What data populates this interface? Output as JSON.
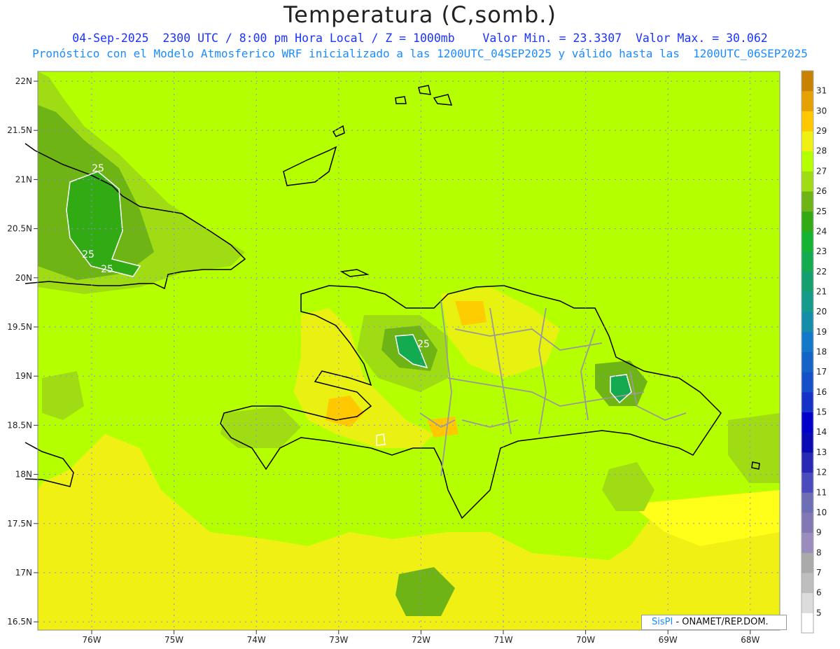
{
  "header": {
    "title": "Temperatura (C,somb.)",
    "line1": "04-Sep-2025  2300 UTC / 8:00 pm Hora Local / Z = 1000mb    Valor Min. = 23.3307  Valor Max. = 30.062",
    "line2": "Pronóstico con el Modelo Atmosferico WRF inicializado a las 1200UTC_04SEP2025 y válido hasta las  1200UTC_06SEP2025"
  },
  "axes": {
    "lat_labels": [
      "22N",
      "21.5N",
      "21N",
      "20.5N",
      "20N",
      "19.5N",
      "19N",
      "18.5N",
      "18N",
      "17.5N",
      "17N",
      "16.5N"
    ],
    "lon_labels": [
      "76W",
      "75W",
      "74W",
      "73W",
      "72W",
      "71W",
      "70W",
      "69W",
      "68W"
    ]
  },
  "colorbar": {
    "labels": [
      "5",
      "6",
      "7",
      "8",
      "9",
      "10",
      "11",
      "12",
      "13",
      "14",
      "15",
      "16",
      "17",
      "18",
      "19",
      "20",
      "21",
      "22",
      "23",
      "24",
      "25",
      "26",
      "27",
      "28",
      "29",
      "30",
      "31"
    ],
    "colors": [
      "#ffffff",
      "#dcdcdc",
      "#bebebe",
      "#aaaaaa",
      "#9b8cbe",
      "#8278b4",
      "#6e6eb4",
      "#4b4bbe",
      "#2828b4",
      "#0a0ab4",
      "#0000c8",
      "#1432c8",
      "#1450c8",
      "#1464c8",
      "#1478c8",
      "#148caa",
      "#149b8c",
      "#14a06e",
      "#14aa50",
      "#14b432",
      "#32aa14",
      "#6eb414",
      "#a0dc14",
      "#b4ff00",
      "#f0f014",
      "#ffc800",
      "#e6a000",
      "#c88200"
    ]
  },
  "contour_labels": [
    "25",
    "25",
    "25",
    "25"
  ],
  "credit": {
    "sis": "SisPI",
    "org": "- ONAMET/REP.DOM."
  }
}
